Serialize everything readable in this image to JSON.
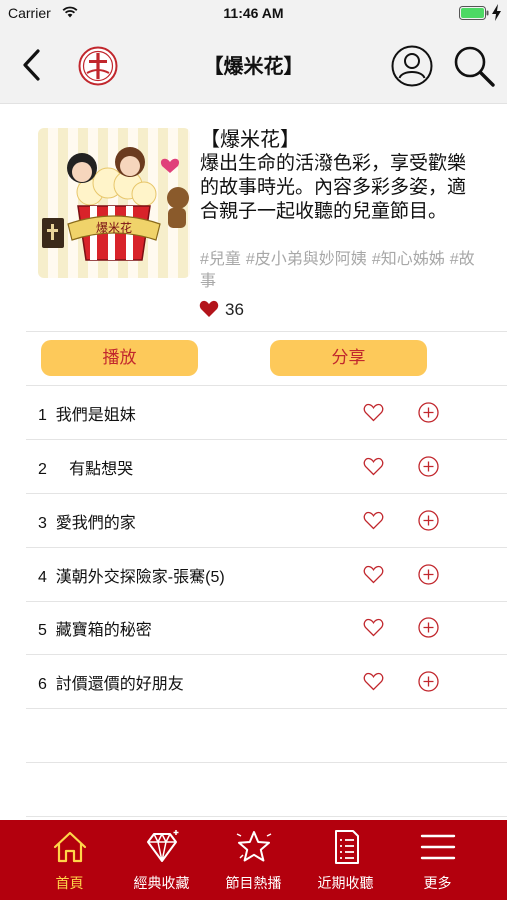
{
  "status_bar": {
    "carrier": "Carrier",
    "time": "11:46 AM"
  },
  "nav": {
    "title": "【爆米花】",
    "back_icon": "chevron-left-icon",
    "logo_icon": "cross-logo-icon",
    "user_icon": "user-icon",
    "search_icon": "search-icon"
  },
  "program": {
    "name": "【爆米花】",
    "description": "爆出生命的活潑色彩，享受歡樂的故事時光。內容多彩多姿，適合親子一起收聽的兒童節目。",
    "tags": [
      "#兒童",
      "#皮小弟與妙阿姨",
      "#知心姊姊",
      "#故事"
    ],
    "likes": "36",
    "cover_text": "爆米花"
  },
  "actions": {
    "play": "播放",
    "share": "分享"
  },
  "episodes": [
    {
      "title": "1  我們是姐妹"
    },
    {
      "title": "2     有點想哭"
    },
    {
      "title": "3  愛我們的家"
    },
    {
      "title": "4  漢朝外交探險家-張騫(5)"
    },
    {
      "title": "5  藏寶箱的秘密"
    },
    {
      "title": "6  討價還價的好朋友"
    }
  ],
  "tabs": [
    {
      "label": "首頁",
      "icon": "home-icon",
      "active": true
    },
    {
      "label": "經典收藏",
      "icon": "diamond-icon",
      "active": false
    },
    {
      "label": "節目熱播",
      "icon": "star-icon",
      "active": false
    },
    {
      "label": "近期收聽",
      "icon": "list-document-icon",
      "active": false
    },
    {
      "label": "更多",
      "icon": "hamburger-menu-icon",
      "active": false
    }
  ],
  "colors": {
    "accent_red": "#b3000d",
    "button_yellow": "#fdc95a",
    "icon_red": "#c1272d",
    "tab_active": "#ffd54a",
    "tag_gray": "#a8a8a8"
  }
}
